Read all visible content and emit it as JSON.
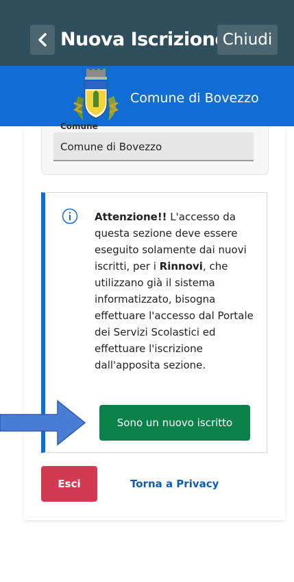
{
  "header": {
    "title": "Nuova Iscrizione",
    "close_label": "Chiudi"
  },
  "banner": {
    "comune_name": "Comune di Bovezzo"
  },
  "form": {
    "field_label": "Comune",
    "field_value": "Comune di Bovezzo"
  },
  "notice": {
    "strong_intro": "Attenzione!!",
    "text_1": " L'accesso da questa sezione deve essere eseguito solamente dai nuovi iscritti, per i ",
    "strong_rinnovi": "Rinnovi",
    "text_2": ", che utilizzano già il sistema informatizzato, bisogna effettuare l'accesso dal Portale dei Servizi Scolastici ed effettuare l'iscrizione dall'apposita sezione."
  },
  "actions": {
    "new_user_label": "Sono un nuovo iscritto",
    "exit_label": "Esci",
    "privacy_label": "Torna a Privacy"
  },
  "colors": {
    "header_bg": "#2f4f5c",
    "brand_blue": "#0f6dd3",
    "primary_green": "#098149",
    "exit_red": "#d23a52",
    "arrow_blue": "#4a7ed6"
  }
}
